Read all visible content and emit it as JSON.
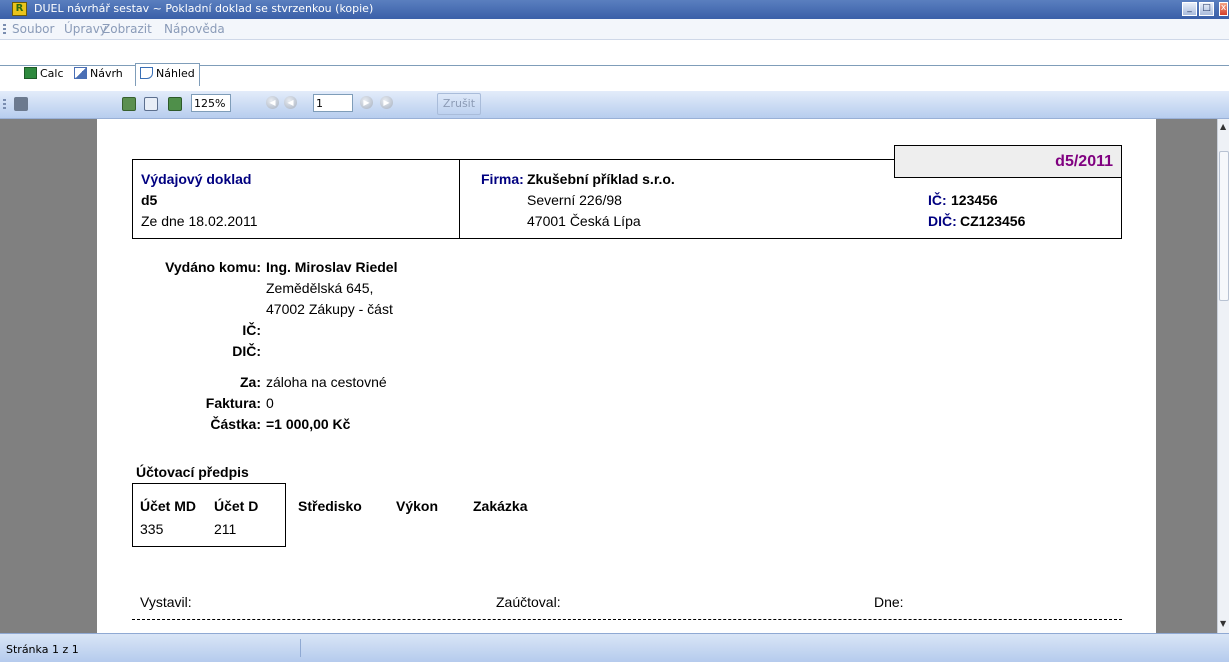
{
  "window": {
    "app_icon_letter": "R",
    "title": "DUEL návrhář sestav ~ Pokladní doklad se stvrzenkou (kopie)"
  },
  "menu": {
    "items": [
      "Soubor",
      "Úpravy",
      "Zobrazit",
      "Nápověda"
    ]
  },
  "tabs": [
    {
      "label": "Calc",
      "icon": "calculator-icon"
    },
    {
      "label": "Návrh",
      "icon": "edit-icon"
    },
    {
      "label": "Náhled",
      "icon": "preview-icon",
      "active": true
    }
  ],
  "toolbar": {
    "zoom": "125%",
    "page": "1",
    "cancel_label": "Zrušit"
  },
  "document": {
    "doc_number": "d5/2011",
    "doc_type": "Výdajový doklad",
    "doc_code": "d5",
    "date_text": "Ze dne 18.02.2011",
    "firm_label": "Firma:",
    "firm_name": "Zkušební příklad s.r.o.",
    "firm_street": "Severní 226/98",
    "firm_city": "47001  Česká Lípa",
    "ic_label": "IČ:",
    "ic_value": "123456",
    "dic_label": "DIČ:",
    "dic_value": "CZ123456",
    "issued_to_label": "Vydáno komu:",
    "issued_to_name": "Ing. Miroslav Riedel",
    "issued_to_street": "Zemědělská 645,",
    "issued_to_city": "47002  Zákupy - část",
    "recipient_ic_label": "IČ:",
    "recipient_dic_label": "DIČ:",
    "for_label": "Za:",
    "for_value": "záloha na cestovné",
    "invoice_label": "Faktura:",
    "invoice_value": "0",
    "amount_label": "Částka:",
    "amount_value": "=1 000,00 Kč",
    "posting_title": "Účtovací předpis",
    "columns": [
      "Účet MD",
      "Účet D",
      "Středisko",
      "Výkon",
      "Zakázka"
    ],
    "row": [
      "335",
      "211"
    ],
    "issued_by": "Vystavil:",
    "posted_by": "Zaúčtoval:",
    "date_label": "Dne:"
  },
  "status": {
    "page_text": "Stránka 1 z 1"
  },
  "colors": {
    "titlebar": "#3a5fa8",
    "doc_number": "#800080",
    "doc_type": "#000080",
    "preview_bg": "#808080"
  }
}
